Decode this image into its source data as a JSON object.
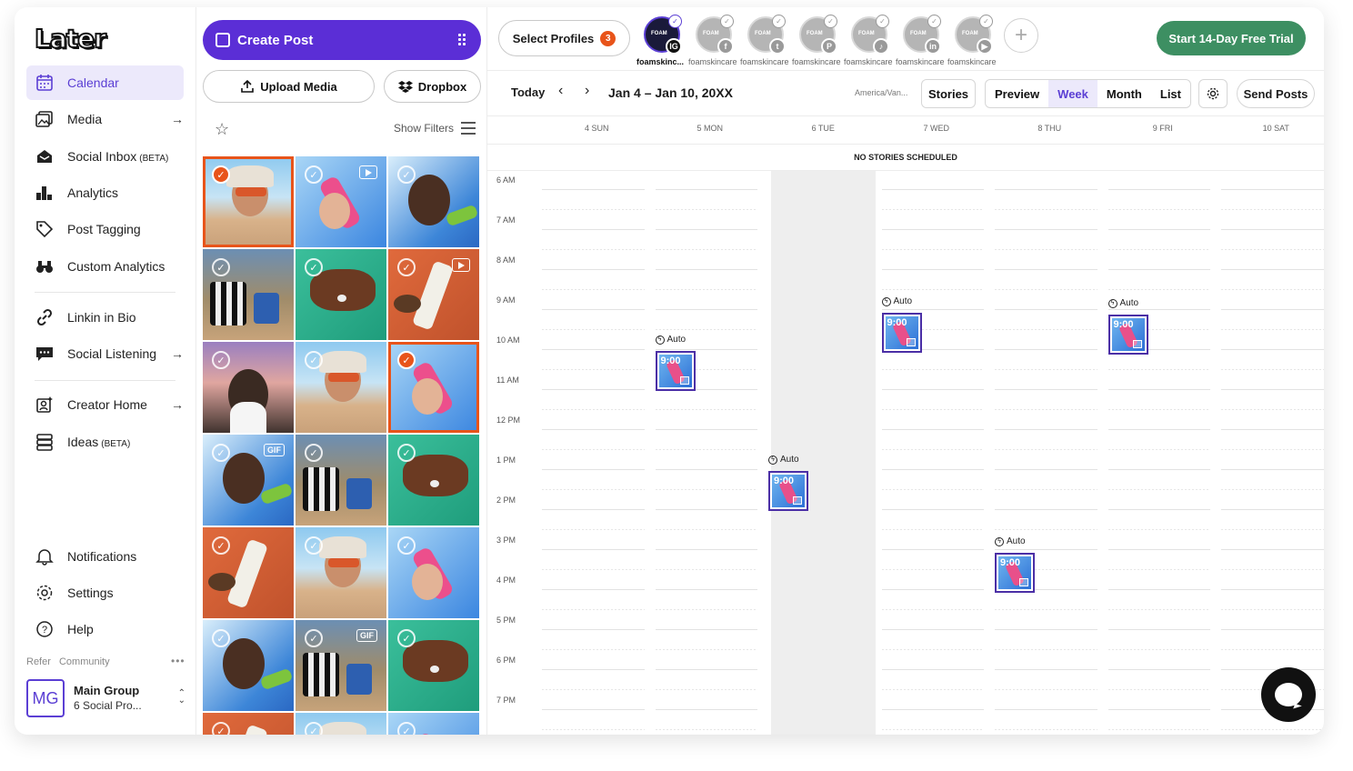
{
  "brand": {
    "logo": "Later",
    "accent": "#5b2ed6",
    "orange": "#e8541a",
    "green": "#3d8f62"
  },
  "nav": {
    "items": [
      {
        "label": "Calendar",
        "badge": "",
        "icon": "calendar-icon",
        "active": true,
        "arrow": ""
      },
      {
        "label": "Media",
        "badge": "",
        "icon": "media-icon",
        "active": false,
        "arrow": "→"
      },
      {
        "label": "Social Inbox",
        "badge": "(BETA)",
        "icon": "inbox-icon",
        "active": false,
        "arrow": ""
      },
      {
        "label": "Analytics",
        "badge": "",
        "icon": "analytics-icon",
        "active": false,
        "arrow": ""
      },
      {
        "label": "Post Tagging",
        "badge": "",
        "icon": "tag-icon",
        "active": false,
        "arrow": ""
      },
      {
        "label": "Custom Analytics",
        "badge": "",
        "icon": "binoculars-icon",
        "active": false,
        "arrow": ""
      },
      {
        "label": "Linkin in Bio",
        "badge": "",
        "icon": "link-icon",
        "active": false,
        "arrow": ""
      },
      {
        "label": "Social Listening",
        "badge": "",
        "icon": "chat-icon",
        "active": false,
        "arrow": "→"
      },
      {
        "label": "Creator Home",
        "badge": "",
        "icon": "creator-icon",
        "active": false,
        "arrow": "→"
      },
      {
        "label": "Ideas",
        "badge": "(BETA)",
        "icon": "ideas-icon",
        "active": false,
        "arrow": ""
      }
    ],
    "bottom": [
      {
        "label": "Notifications",
        "icon": "bell-icon"
      },
      {
        "label": "Settings",
        "icon": "gear-icon"
      },
      {
        "label": "Help",
        "icon": "help-icon"
      }
    ],
    "refer": "Refer",
    "community": "Community",
    "more": "•••",
    "group": {
      "initials": "MG",
      "title": "Main Group",
      "subtitle": "6 Social Pro..."
    }
  },
  "media": {
    "create_post": "Create Post",
    "upload_media": "Upload Media",
    "dropbox": "Dropbox",
    "show_filters": "Show Filters",
    "tiles": [
      {
        "scene": "woman-bandana",
        "selected": true,
        "badge": ""
      },
      {
        "scene": "bottle-blue",
        "selected": false,
        "badge": "video"
      },
      {
        "scene": "man-sky",
        "selected": false,
        "badge": ""
      },
      {
        "scene": "bag-beach",
        "selected": false,
        "badge": ""
      },
      {
        "scene": "hand-green",
        "selected": false,
        "badge": ""
      },
      {
        "scene": "sunscreen-towel",
        "selected": false,
        "badge": "video"
      },
      {
        "scene": "man-sunset",
        "selected": false,
        "badge": ""
      },
      {
        "scene": "woman-bandana",
        "selected": false,
        "badge": ""
      },
      {
        "scene": "bottle-blue",
        "selected": true,
        "badge": ""
      },
      {
        "scene": "man-sky",
        "selected": false,
        "badge": "GIF"
      },
      {
        "scene": "bag-beach",
        "selected": false,
        "badge": ""
      },
      {
        "scene": "hand-green",
        "selected": false,
        "badge": ""
      },
      {
        "scene": "sunscreen-towel",
        "selected": false,
        "badge": ""
      },
      {
        "scene": "woman-bandana",
        "selected": false,
        "badge": ""
      },
      {
        "scene": "bottle-blue",
        "selected": false,
        "badge": ""
      },
      {
        "scene": "man-sky",
        "selected": false,
        "badge": ""
      },
      {
        "scene": "bag-beach",
        "selected": false,
        "badge": "GIF"
      },
      {
        "scene": "hand-green",
        "selected": false,
        "badge": ""
      },
      {
        "scene": "sunscreen-towel",
        "selected": false,
        "badge": ""
      },
      {
        "scene": "woman-bandana",
        "selected": false,
        "badge": ""
      },
      {
        "scene": "bottle-blue",
        "selected": false,
        "badge": ""
      }
    ]
  },
  "profiles": {
    "select_label": "Select Profiles",
    "count": "3",
    "avatar_text": "FOAM",
    "list": [
      {
        "name": "foamskinc...",
        "network": "IG",
        "icon": "instagram-icon",
        "active": true
      },
      {
        "name": "foamskincare",
        "network": "f",
        "icon": "facebook-icon",
        "active": false
      },
      {
        "name": "foamskincare",
        "network": "t",
        "icon": "twitter-icon",
        "active": false
      },
      {
        "name": "foamskincare",
        "network": "P",
        "icon": "pinterest-icon",
        "active": false
      },
      {
        "name": "foamskincare",
        "network": "♪",
        "icon": "tiktok-icon",
        "active": false
      },
      {
        "name": "foamskincare",
        "network": "in",
        "icon": "linkedin-icon",
        "active": false
      },
      {
        "name": "foamskincare",
        "network": "▶",
        "icon": "youtube-icon",
        "active": false
      }
    ],
    "trial": "Start 14-Day Free Trial"
  },
  "calendar": {
    "today": "Today",
    "prev": "‹",
    "next": "›",
    "range": "Jan 4 – Jan 10, 20XX",
    "timezone": "America/Van...",
    "stories": "Stories",
    "views": [
      {
        "label": "Preview",
        "on": false
      },
      {
        "label": "Week",
        "on": true
      },
      {
        "label": "Month",
        "on": false
      },
      {
        "label": "List",
        "on": false
      }
    ],
    "send_posts": "Send Posts",
    "days": [
      "4 SUN",
      "5 MON",
      "6 TUE",
      "7 WED",
      "8 THU",
      "9 FRI",
      "10 SAT"
    ],
    "no_stories": "NO STORIES SCHEDULED",
    "hours": [
      "6 AM",
      "7 AM",
      "8 AM",
      "9 AM",
      "10 AM",
      "11 AM",
      "12 PM",
      "1 PM",
      "2 PM",
      "3 PM",
      "4 PM",
      "5 PM",
      "6 PM",
      "7 PM"
    ],
    "posts": [
      {
        "day": 1,
        "hour": 10.5,
        "time": "9:00",
        "label": "Auto"
      },
      {
        "day": 2,
        "hour": 13.5,
        "time": "9:00",
        "label": "Auto"
      },
      {
        "day": 3,
        "hour": 9.55,
        "time": "9:00",
        "label": "Auto"
      },
      {
        "day": 4,
        "hour": 15.55,
        "time": "9:00",
        "label": "Auto"
      },
      {
        "day": 5,
        "hour": 9.6,
        "time": "9:00",
        "label": "Auto"
      }
    ],
    "shaded_day": 2
  }
}
